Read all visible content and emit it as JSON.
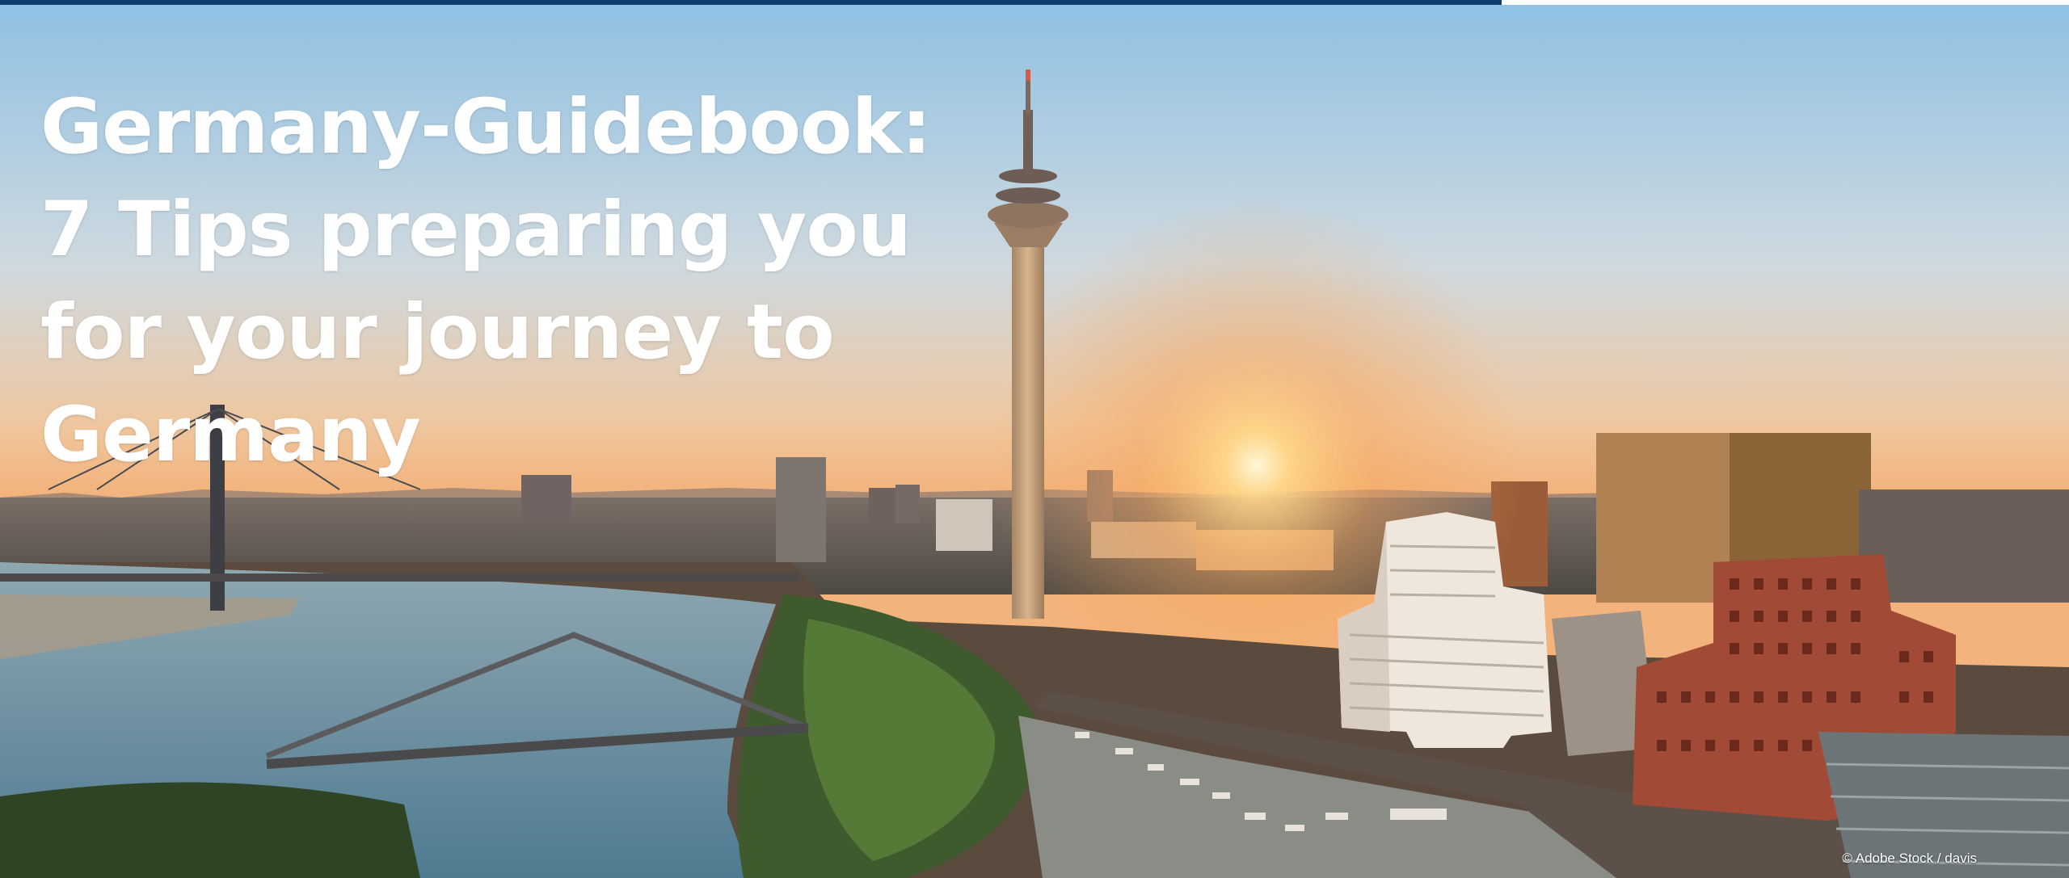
{
  "slide": {
    "headline_lines": [
      "Germany-Guidebook:",
      "7 Tips preparing you",
      "for your journey to",
      "Germany"
    ],
    "photo_credit": "© Adobe Stock / davis"
  },
  "colors": {
    "top_bar": "#0d3e6e",
    "headline_text": "#ffffff",
    "sky_top": "#8fc1e3",
    "sky_horizon": "#f3b37c",
    "sun": "#fff2c2",
    "river": "#5f879b"
  },
  "icons": {
    "photo": "city-skyline-photo"
  }
}
